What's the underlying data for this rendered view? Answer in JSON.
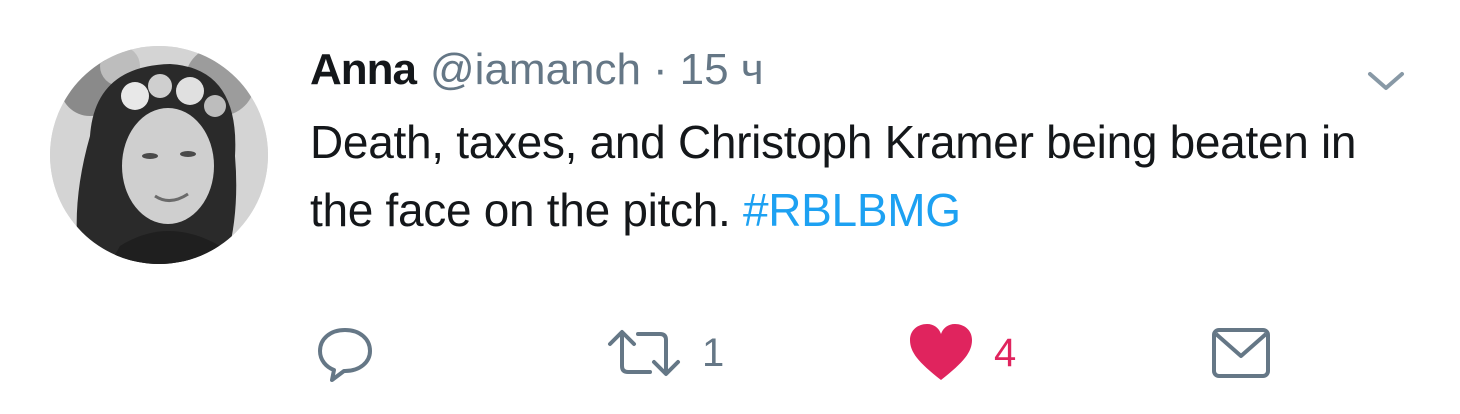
{
  "tweet": {
    "author_name": "Anna",
    "author_handle": "@iamanch",
    "separator": "·",
    "timestamp": "15 ч",
    "text_main": "Death, taxes, and Christoph Kramer being beaten in the face on the pitch.",
    "hashtag": "#RBLBMG"
  },
  "actions": {
    "reply_count": "",
    "retweet_count": "1",
    "like_count": "4",
    "liked": true
  },
  "icons": {
    "reply": "speech-bubble-icon",
    "retweet": "retweet-arrows-icon",
    "like": "heart-icon",
    "message": "envelope-icon",
    "menu": "chevron-down-icon"
  },
  "colors": {
    "text": "#14171a",
    "secondary": "#657786",
    "hashtag": "#1da1f2",
    "like": "#e0245e",
    "icon": "#657786"
  }
}
